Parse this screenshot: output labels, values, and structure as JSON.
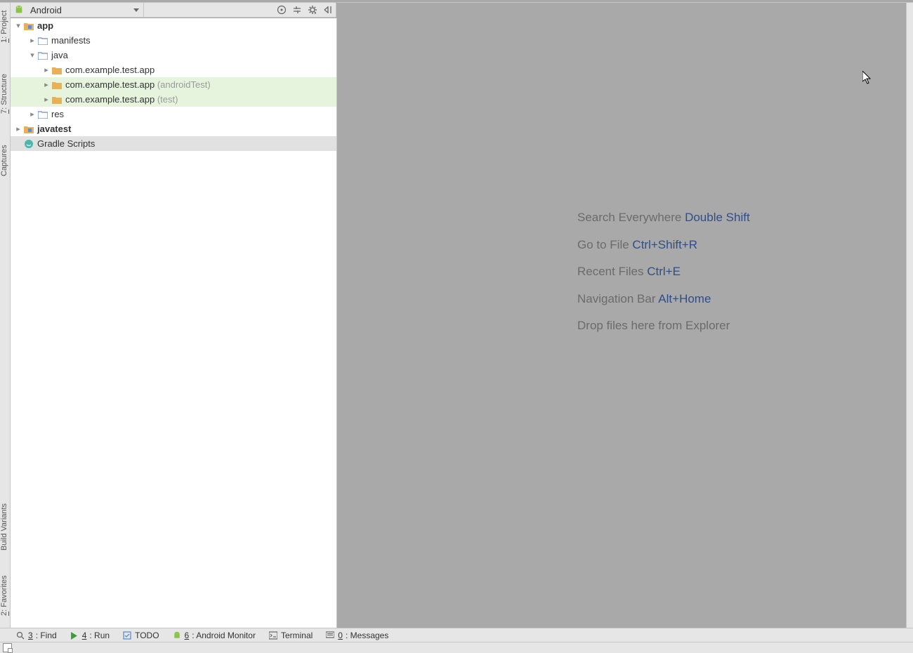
{
  "left_tabs": {
    "project": {
      "label": "1: Project",
      "num": "1",
      "rest": ": Project"
    },
    "structure": {
      "label": "7: Structure",
      "num": "7",
      "rest": ": Structure"
    },
    "captures": {
      "label": "Captures"
    },
    "buildvar": {
      "label": "Build Variants"
    },
    "favorites": {
      "label": "2: Favorites",
      "num": "2",
      "rest": ": Favorites"
    }
  },
  "project_header": {
    "view_selector": "Android"
  },
  "tree": {
    "app": "app",
    "manifests": "manifests",
    "java": "java",
    "pkg_main": "com.example.test.app",
    "pkg_atest": "com.example.test.app",
    "pkg_atest_suf": "(androidTest)",
    "pkg_test": "com.example.test.app",
    "pkg_test_suf": "(test)",
    "res": "res",
    "javatest": "javatest",
    "gradle": "Gradle Scripts"
  },
  "editor": {
    "search": {
      "text": "Search Everywhere ",
      "key": "Double Shift"
    },
    "gotofile": {
      "text": "Go to File ",
      "key": "Ctrl+Shift+R"
    },
    "recent": {
      "text": "Recent Files ",
      "key": "Ctrl+E"
    },
    "navbar": {
      "text": "Navigation Bar ",
      "key": "Alt+Home"
    },
    "drop": {
      "text": "Drop files here from Explorer"
    }
  },
  "bottom": {
    "find": {
      "num": "3",
      "label": ": Find"
    },
    "run": {
      "num": "4",
      "label": ": Run"
    },
    "todo": {
      "label": "TODO"
    },
    "amon": {
      "num": "6",
      "label": ": Android Monitor"
    },
    "term": {
      "label": "Terminal"
    },
    "messages": {
      "num": "0",
      "label": ": Messages"
    }
  }
}
